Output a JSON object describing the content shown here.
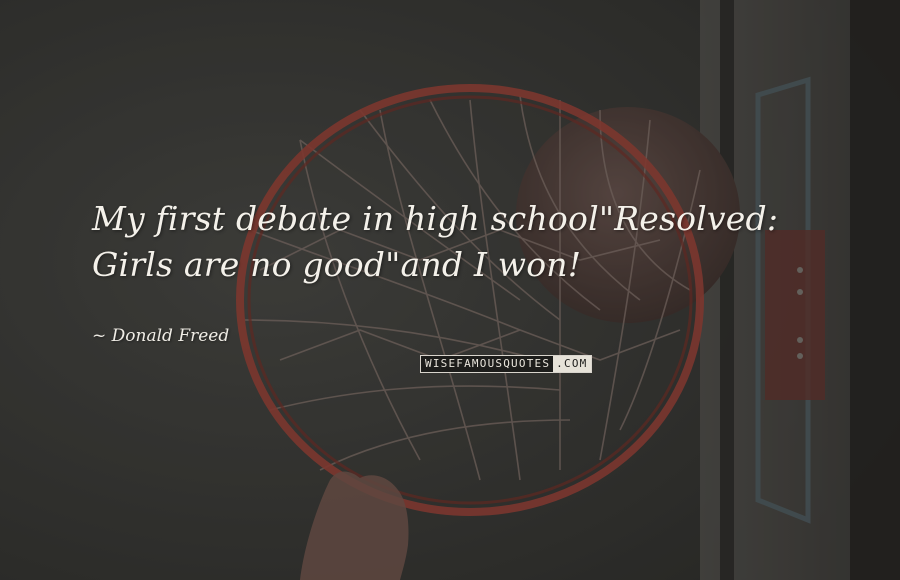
{
  "quote": {
    "lines": [
      "My first debate in high school\"Resolved:",
      "Girls are no good\"and I won!"
    ]
  },
  "author": {
    "prefix": "~",
    "name": "Donald Freed"
  },
  "watermark": {
    "part_a": "WISEFAMOUSQUOTES",
    "part_b": ".COM"
  },
  "colors": {
    "text": "#f4f1ea",
    "rim": "#a3443a",
    "background": "#3a3a38"
  },
  "background_subject": "basketball hoop and net seen from below"
}
